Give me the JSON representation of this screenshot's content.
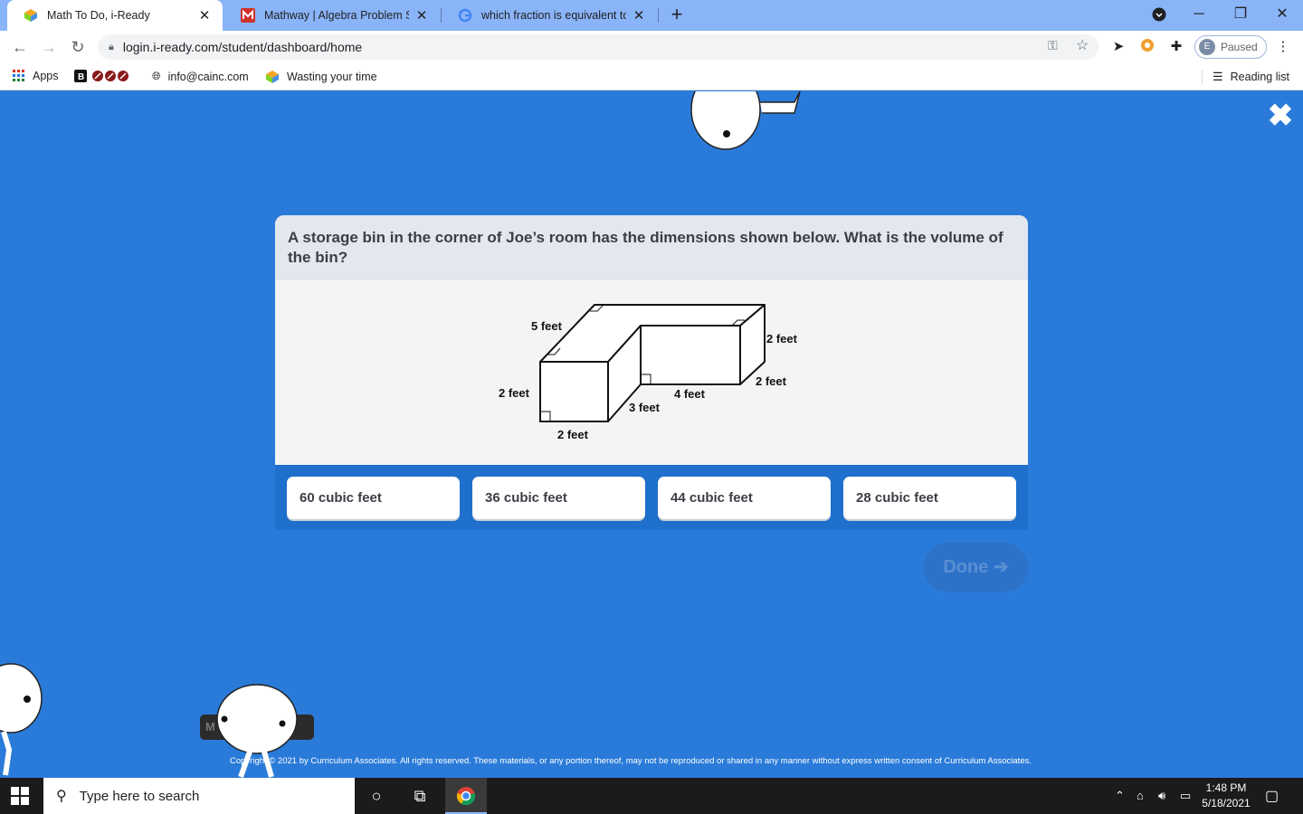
{
  "browser": {
    "tabs": [
      {
        "title": "Math To Do, i-Ready",
        "active": true
      },
      {
        "title": "Mathway | Algebra Problem Solv",
        "active": false
      },
      {
        "title": "which fraction is equivalent to -3",
        "active": false
      }
    ],
    "url": "login.i-ready.com/student/dashboard/home",
    "profile_initial": "E",
    "profile_status": "Paused",
    "bookmarks": [
      {
        "label": "Apps"
      },
      {
        "label": ""
      },
      {
        "label": "info@cainc.com"
      },
      {
        "label": "Wasting your time"
      }
    ],
    "reading_list": "Reading list"
  },
  "question": {
    "text": "A storage bin in the corner of Joe’s room has the dimensions shown below. What is the volume of the bin?",
    "figure_labels": {
      "top_depth": "5 feet",
      "left_height": "2 feet",
      "front_width": "2 feet",
      "side_depth": "3 feet",
      "right_length": "4 feet",
      "right_height": "2 feet",
      "right_width": "2 feet"
    },
    "answers": [
      "60 cubic feet",
      "36 cubic feet",
      "44 cubic feet",
      "28 cubic feet"
    ],
    "done_label": "Done"
  },
  "footer": {
    "copyright": "Copyright © 2021 by Curriculum Associates. All rights reserved. These materials, or any portion thereof, may not be reproduced or shared in any manner without express written consent of Curriculum Associates.",
    "mini_label": "M"
  },
  "taskbar": {
    "search_placeholder": "Type here to search",
    "time": "1:48 PM",
    "date": "5/18/2021"
  },
  "colors": {
    "page_bg": "#2a7bd9",
    "answers_bar": "#1f6fcc",
    "tabbar": "#8ab4f8"
  }
}
